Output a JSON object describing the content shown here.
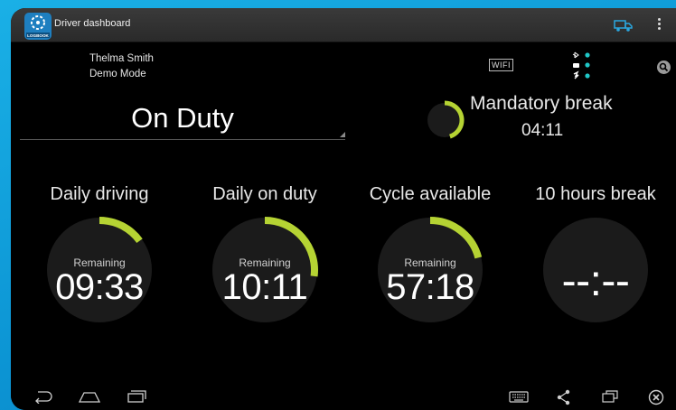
{
  "app": {
    "title": "Driver dashboard",
    "logo_text": "LOGBOOK"
  },
  "driver": {
    "name": "Thelma Smith",
    "mode": "Demo Mode"
  },
  "status": {
    "current": "On Duty"
  },
  "indicators": {
    "wifi": "WIFI"
  },
  "mandatory_break": {
    "label": "Mandatory break",
    "time": "04:11",
    "progress": 0.45
  },
  "gauges": [
    {
      "title": "Daily driving",
      "remaining_label": "Remaining",
      "time": "09:33",
      "progress": 0.15
    },
    {
      "title": "Daily on duty",
      "remaining_label": "Remaining",
      "time": "10:11",
      "progress": 0.27
    },
    {
      "title": "Cycle available",
      "remaining_label": "Remaining",
      "time": "57:18",
      "progress": 0.21
    },
    {
      "title": "10 hours break",
      "remaining_label": "",
      "time": "--:--",
      "progress": 0
    }
  ],
  "colors": {
    "accent": "#b5d333",
    "gauge_bg": "#1b1b1b",
    "background": "#000000",
    "desktop": "#1aa6e0"
  },
  "icons": {
    "truck": "truck-icon",
    "overflow": "overflow-menu-icon",
    "search": "search-icon",
    "bluetooth": "bluetooth-icon",
    "back": "back-icon",
    "home": "home-icon",
    "recents": "recents-icon",
    "keyboard": "keyboard-icon",
    "share": "share-icon",
    "window": "window-icon",
    "close": "close-icon"
  }
}
